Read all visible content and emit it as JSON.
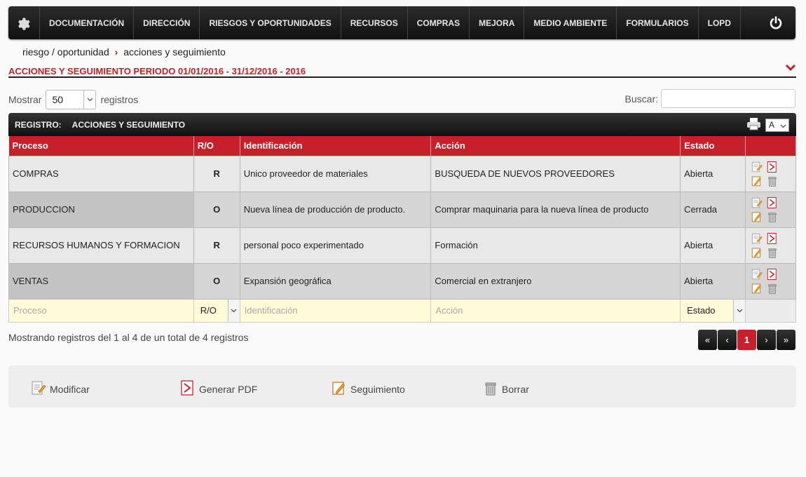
{
  "nav": {
    "items": [
      "DOCUMENTACIÓN",
      "DIRECCIÓN",
      "RIESGOS Y OPORTUNIDADES",
      "RECURSOS",
      "COMPRAS",
      "MEJORA",
      "MEDIO AMBIENTE",
      "FORMULARIOS",
      "LOPD"
    ]
  },
  "breadcrumb": {
    "parent": "riesgo / oportunidad",
    "separator": "›",
    "current": "acciones y seguimiento"
  },
  "section_title": "ACCIONES Y SEGUIMIENTO PERIODO 01/01/2016 - 31/12/2016 - 2016",
  "length_menu": {
    "prefix": "Mostrar",
    "value": "50",
    "suffix": "registros"
  },
  "search": {
    "label": "Buscar:",
    "value": ""
  },
  "table_bar": {
    "label": "REGISTRO:",
    "name": "ACCIONES Y SEGUIMIENTO",
    "font_value": "A"
  },
  "columns": [
    "Proceso",
    "R/O",
    "Identificación",
    "Acción",
    "Estado",
    ""
  ],
  "rows": [
    {
      "proceso": "COMPRAS",
      "ro": "R",
      "identificacion": "Unico proveedor de materiales",
      "accion": "BUSQUEDA DE NUEVOS PROVEEDORES",
      "estado": "Abierta"
    },
    {
      "proceso": "PRODUCCION",
      "ro": "O",
      "identificacion": "Nueva línea de producción de producto.",
      "accion": "Comprar maquinaria para la nueva línea de producto",
      "estado": "Cerrada"
    },
    {
      "proceso": "RECURSOS HUMANOS Y FORMACION",
      "ro": "R",
      "identificacion": "personal poco experimentado",
      "accion": "Formación",
      "estado": "Abierta"
    },
    {
      "proceso": "VENTAS",
      "ro": "O",
      "identificacion": "Expansión geográfica",
      "accion": "Comercial en extranjero",
      "estado": "Abierta"
    }
  ],
  "filters": {
    "proceso": "Proceso",
    "ro": "R/O",
    "identificacion": "Identificación",
    "accion": "Acción",
    "estado": "Estado"
  },
  "info": "Mostrando registros del 1 al 4 de un total de 4 registros",
  "pager": {
    "first": "«",
    "prev": "‹",
    "current": "1",
    "next": "›",
    "last": "»"
  },
  "legend": {
    "modificar": "Modificar",
    "pdf": "Generar PDF",
    "seguimiento": "Seguimiento",
    "borrar": "Borrar"
  },
  "colors": {
    "accent": "#c8202a",
    "nav_bg": "#1a1a1a",
    "filter_bg": "#fffbd8"
  }
}
